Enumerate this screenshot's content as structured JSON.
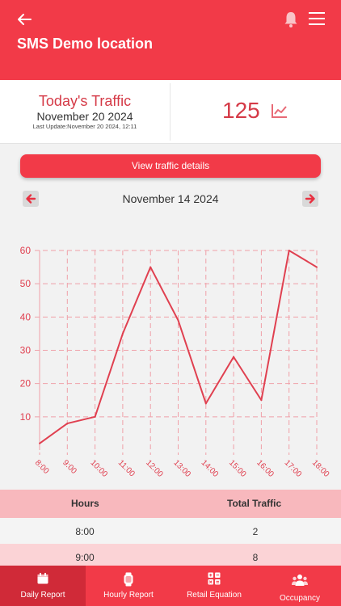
{
  "header": {
    "title": "SMS Demo location",
    "back_icon": "arrow-left-icon",
    "bell_icon": "bell-icon",
    "menu_icon": "hamburger-menu-icon"
  },
  "summary": {
    "title": "Today's Traffic",
    "date": "November 20 2024",
    "last_update": "Last Update:November 20 2024, 12:11",
    "count": "125",
    "trend_icon": "trend-chart-icon"
  },
  "details_button": "View traffic details",
  "date_nav": {
    "prev_icon": "arrow-left-icon",
    "next_icon": "arrow-right-icon",
    "current": "November 14 2024"
  },
  "colors": {
    "brand": "#f23a48",
    "chart_line": "#e04050",
    "grid": "#f0a0a8",
    "table_header": "#f8b8bd"
  },
  "chart_data": {
    "type": "line",
    "categories": [
      "8:00",
      "9:00",
      "10:00",
      "11:00",
      "12:00",
      "13:00",
      "14:00",
      "15:00",
      "16:00",
      "17:00",
      "18:00"
    ],
    "values": [
      2,
      8,
      10,
      35,
      55,
      39,
      14,
      28,
      15,
      60,
      55
    ],
    "yticks": [
      10,
      20,
      30,
      40,
      50,
      60
    ],
    "ylim": [
      0,
      60
    ],
    "grid": true
  },
  "table": {
    "headers": [
      "Hours",
      "Total Traffic"
    ],
    "rows": [
      [
        "8:00",
        "2"
      ],
      [
        "9:00",
        "8"
      ]
    ]
  },
  "tabs": [
    {
      "label": "Daily Report",
      "icon": "calendar-icon"
    },
    {
      "label": "Hourly Report",
      "icon": "watch-icon"
    },
    {
      "label": "Retail Equation",
      "icon": "calculator-icon"
    },
    {
      "label": "Occupancy",
      "icon": "people-icon"
    }
  ]
}
